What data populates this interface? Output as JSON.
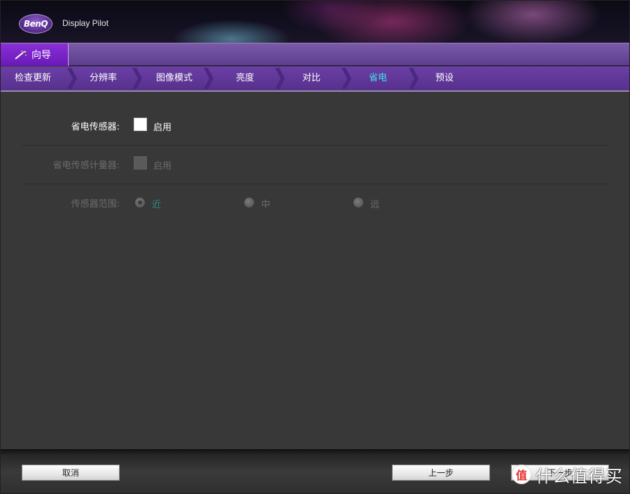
{
  "header": {
    "logo_text": "BenQ",
    "app_title": "Display Pilot"
  },
  "wizard_tab": {
    "label": "向导",
    "icon": "magic-wand-icon"
  },
  "steps": [
    {
      "label": "检查更新",
      "active": false
    },
    {
      "label": "分辨率",
      "active": false
    },
    {
      "label": "图像模式",
      "active": false
    },
    {
      "label": "亮度",
      "active": false
    },
    {
      "label": "对比",
      "active": false
    },
    {
      "label": "省电",
      "active": true
    },
    {
      "label": "预设",
      "active": false
    }
  ],
  "content": {
    "power_sensor": {
      "label": "省电传感器:",
      "checkbox_label": "启用",
      "checked": false,
      "enabled": true
    },
    "sensor_meter": {
      "label": "省电传感计量器:",
      "checkbox_label": "启用",
      "checked": false,
      "enabled": false
    },
    "sensor_range": {
      "label": "传感器范围:",
      "enabled": false,
      "selected": "近",
      "options": [
        "近",
        "中",
        "远"
      ]
    }
  },
  "footer": {
    "cancel_label": "取消",
    "back_label": "上一步",
    "next_label": "下一步"
  },
  "watermark": {
    "badge": "值",
    "text": "什么值得买"
  },
  "colors": {
    "purple": "#6b3fa6",
    "active_step": "#40e0f0",
    "background": "#383838"
  }
}
